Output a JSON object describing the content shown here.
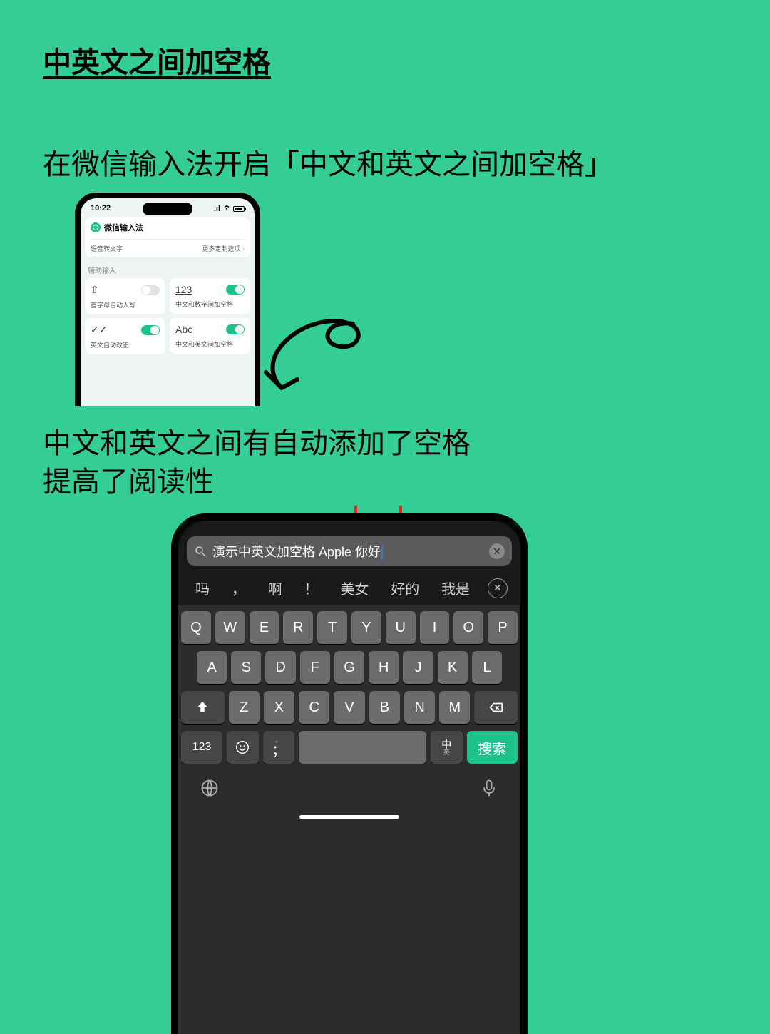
{
  "page": {
    "title": "中英文之间加空格",
    "subtitle1": "在微信输入法开启「中文和英文之间加空格」",
    "subtitle2": "中文和英文之间有自动添加了空格\n提高了阅读性"
  },
  "phone1": {
    "time": "10:22",
    "app_name": "微信输入法",
    "row_left": "语音转文字",
    "row_right": "更多定制选项",
    "section": "辅助输入",
    "cards": [
      {
        "icon": "⇧",
        "label": "首字母自动大写",
        "on": false
      },
      {
        "icon": "123",
        "label": "中文和数字间加空格",
        "on": true
      },
      {
        "icon": "✓✓",
        "label": "英文自动改正",
        "on": true
      },
      {
        "icon": "Abc",
        "label": "中文和英文间加空格",
        "on": true
      }
    ]
  },
  "phone2": {
    "search_text": "演示中英文加空格 Apple 你好",
    "candidates": [
      "吗",
      "，",
      "啊",
      "！",
      "美女",
      "好的",
      "我是"
    ],
    "rows": {
      "r1": [
        "Q",
        "W",
        "E",
        "R",
        "T",
        "Y",
        "U",
        "I",
        "O",
        "P"
      ],
      "r2": [
        "A",
        "S",
        "D",
        "F",
        "G",
        "H",
        "J",
        "K",
        "L"
      ],
      "r3": [
        "Z",
        "X",
        "C",
        "V",
        "B",
        "N",
        "M"
      ]
    },
    "num_key": "123",
    "lang_key_top": "中",
    "lang_key_sub": "英",
    "return_key": "搜索",
    "space_key": "",
    "emoji_key": "☺",
    "semicolon_key_top": "。",
    "semicolon_key": "；"
  }
}
